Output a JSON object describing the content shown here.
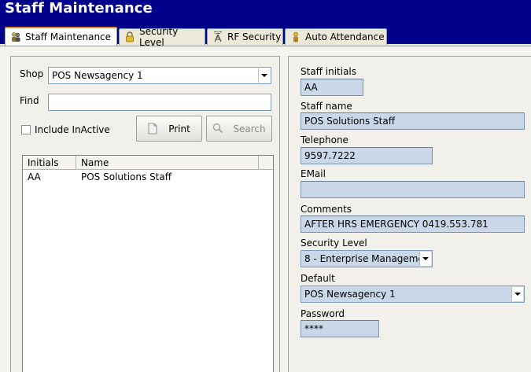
{
  "app": {
    "title": "Staff Maintenance"
  },
  "tabs": [
    {
      "label": "Staff Maintenance",
      "icon": "people-icon",
      "active": true
    },
    {
      "label": "Security Level",
      "icon": "padlock-icon",
      "active": false
    },
    {
      "label": "RF Security",
      "icon": "antenna-icon",
      "active": false
    },
    {
      "label": "Auto Attendance",
      "icon": "person-icon",
      "active": false
    }
  ],
  "left": {
    "shop_label": "Shop",
    "shop_value": "POS Newsagency 1",
    "find_label": "Find",
    "find_value": "",
    "include_inactive_label": "Include InActive",
    "print_label": "Print",
    "search_label": "Search",
    "grid": {
      "headers": [
        "Initials",
        "Name"
      ],
      "rows": [
        {
          "initials": "AA",
          "name": "POS Solutions Staff"
        }
      ]
    }
  },
  "right": {
    "staff_initials_label": "Staff initials",
    "staff_initials_value": "AA",
    "staff_name_label": "Staff name",
    "staff_name_value": "POS Solutions Staff",
    "telephone_label": "Telephone",
    "telephone_value": "9597.7222",
    "email_label": "EMail",
    "email_value": "",
    "comments_label": "Comments",
    "comments_value": "AFTER HRS EMERGENCY 0419.553.781",
    "security_level_label": "Security Level",
    "security_level_value": "8 -  Enterprise Manageme",
    "default_label": "Default",
    "default_value": "POS Newsagency 1",
    "password_label": "Password",
    "password_value": "****"
  },
  "colors": {
    "titlebar": "#00008b",
    "field_bg": "#cad7e8",
    "active_tab_accent": "#e68b2c"
  }
}
